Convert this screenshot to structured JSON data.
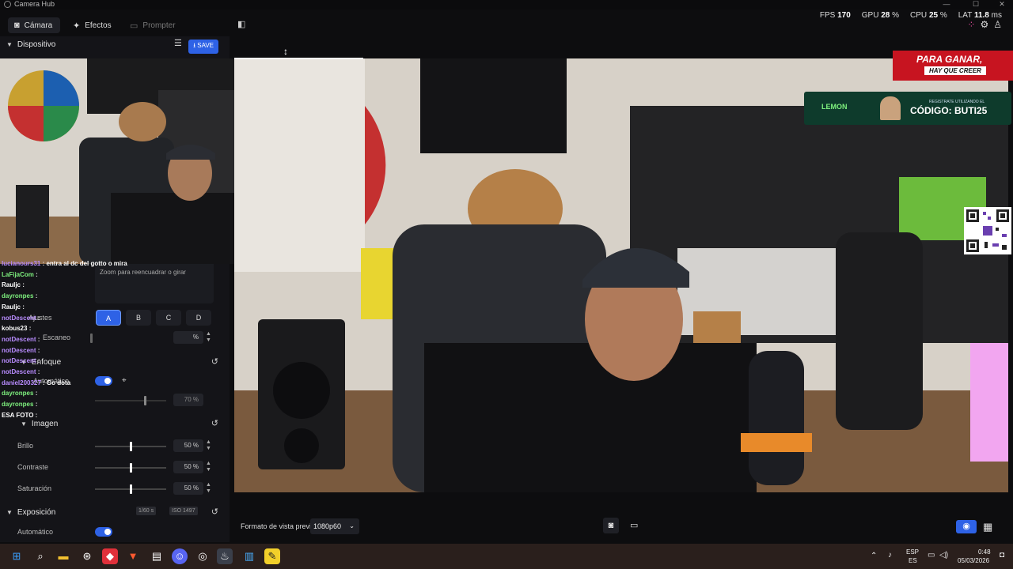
{
  "window": {
    "title": "Camera Hub"
  },
  "tabs": [
    {
      "label": "Cámara",
      "icon": "camera-icon"
    },
    {
      "label": "Efectos",
      "icon": "magic-wand-icon"
    },
    {
      "label": "Prompter",
      "icon": "prompter-icon"
    }
  ],
  "stats": {
    "fps_label": "FPS",
    "fps_value": "170",
    "gpu_label": "GPU",
    "gpu_value": "28",
    "cpu_label": "CPU",
    "cpu_value": "25",
    "lat_label": "LAT",
    "lat_value": "11.8",
    "lat_unit": "ms",
    "percent": "%"
  },
  "sidebar": {
    "device_section": "Dispositivo",
    "save_label": "SAVE",
    "zoom_hint": "Zoom para reencuadrar o girar",
    "presets": [
      "A",
      "B",
      "C",
      "D"
    ],
    "ajustes_label": "Ajustes",
    "escaneo_label": "Escaneo",
    "escaneo_pct": "%",
    "enfoque_label": "Enfoque",
    "automatico_label": "Automático",
    "focus_pct": "70 %",
    "imagen_label": "Imagen",
    "brillo_label": "Brillo",
    "brillo_pct": "50 %",
    "contraste_label": "Contraste",
    "contraste_pct": "50 %",
    "saturacion_label": "Saturación",
    "saturacion_pct": "50 %",
    "exposicion_label": "Exposición",
    "shutter": "1/60 s",
    "iso_label": "ISO",
    "iso_value": "1497",
    "auto_exposure_label": "Automático"
  },
  "chat": [
    {
      "user": "lucianours31",
      "color": "#b98cff",
      "msg": "entra al dc del gotto o mira"
    },
    {
      "user": "LaFijaCom",
      "color": "#7ef07e",
      "msg": ""
    },
    {
      "user": "Rauljc",
      "color": "#ffffff",
      "msg": ""
    },
    {
      "user": "dayronpes",
      "color": "#7ef07e",
      "msg": ""
    },
    {
      "user": "Rauljc",
      "color": "#ffffff",
      "msg": ""
    },
    {
      "user": "notDescent",
      "color": "#b98cff",
      "msg": ""
    },
    {
      "user": "kobus23",
      "color": "#ffffff",
      "msg": ""
    },
    {
      "user": "notDescent",
      "color": "#b98cff",
      "msg": ""
    },
    {
      "user": "notDescent",
      "color": "#b98cff",
      "msg": ""
    },
    {
      "user": "notDescent",
      "color": "#b98cff",
      "msg": ""
    },
    {
      "user": "notDescent",
      "color": "#b98cff",
      "msg": ""
    },
    {
      "user": "daniel200327",
      "color": "#b98cff",
      "msg": "Go dota"
    },
    {
      "user": "dayronpes",
      "color": "#7ef07e",
      "msg": ""
    },
    {
      "user": "dayronpes",
      "color": "#7ef07e",
      "msg": ""
    },
    {
      "user": "ESA FOTO",
      "color": "#ffffff",
      "msg": ""
    }
  ],
  "overlays": {
    "banner_line1": "PARA GANAR,",
    "banner_line2": "HAY QUE CREER",
    "sponsor_brand": "LEMON",
    "sponsor_small": "REGISTRATE UTILIZANDO EL",
    "sponsor_code": "CÓDIGO: BUTI25"
  },
  "preview_bar": {
    "format_label": "Formato de vista previa",
    "format_value": "1080p60"
  },
  "taskbar": {
    "lang_top": "ESP",
    "lang_bottom": "ES",
    "time": "0:48",
    "date": "05/03/2026"
  },
  "colors": {
    "accent": "#2e62e6",
    "banner_red": "#c71420"
  }
}
